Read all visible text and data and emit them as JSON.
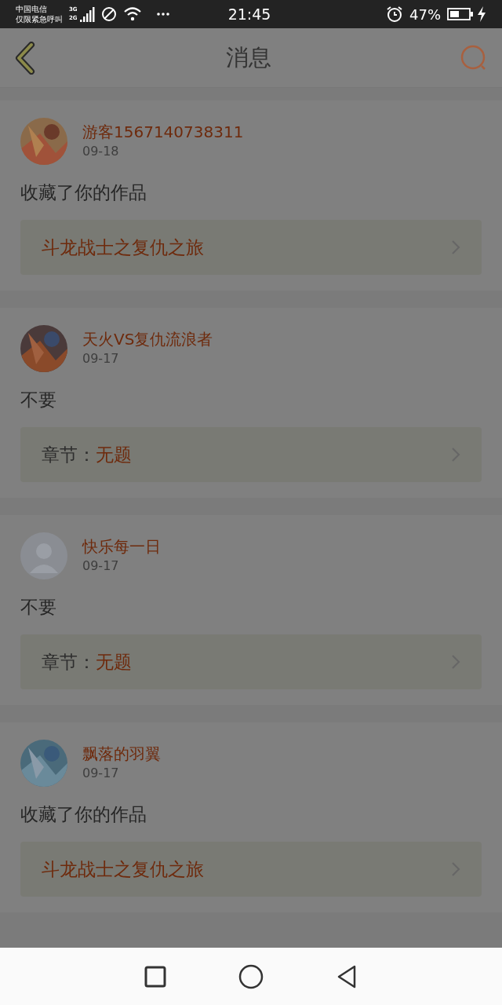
{
  "status_bar": {
    "carrier_line1": "中国电信",
    "carrier_line2": "仅限紧急呼叫",
    "network_top": "3G",
    "network_bottom": "2G",
    "time": "21:45",
    "battery": "47%"
  },
  "header": {
    "title": "消息"
  },
  "messages": [
    {
      "user": "游客1567140738311",
      "date": "09-18",
      "text": "收藏了你的作品",
      "link": {
        "kind": "work",
        "title": "斗龙战士之复仇之旅"
      }
    },
    {
      "user": "天火VS复仇流浪者",
      "date": "09-17",
      "text": "不要",
      "link": {
        "kind": "chapter",
        "label": "章节：",
        "title": "无题"
      }
    },
    {
      "user": "快乐每一日",
      "date": "09-17",
      "avatar": {
        "kind": "default"
      },
      "text": "不要",
      "link": {
        "kind": "chapter",
        "label": "章节：",
        "title": "无题"
      }
    },
    {
      "user": "飘落的羽翼",
      "date": "09-17",
      "text": "收藏了你的作品",
      "link": {
        "kind": "work",
        "title": "斗龙战士之复仇之旅"
      }
    }
  ]
}
